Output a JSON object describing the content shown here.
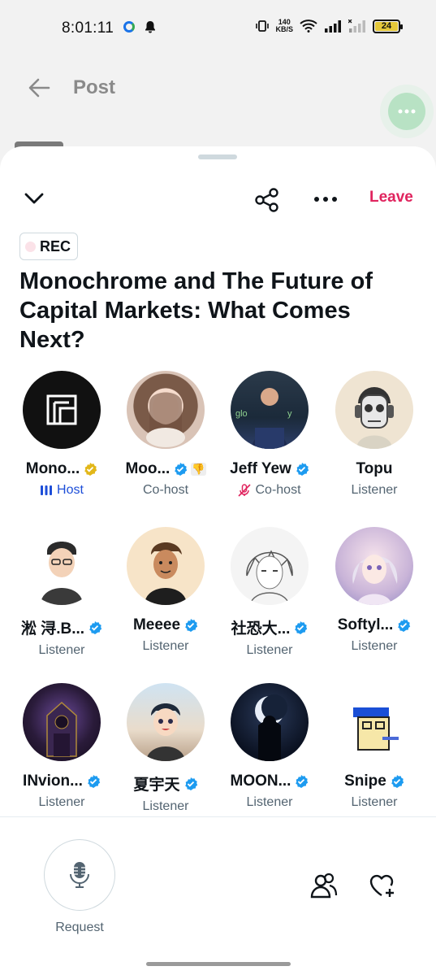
{
  "status_bar": {
    "time": "8:01:11",
    "net_speed_top": "140",
    "net_speed_bottom": "KB/S",
    "battery": "24"
  },
  "post_header": {
    "title": "Post"
  },
  "space": {
    "rec_label": "REC",
    "title": "Monochrome and The Future of Capital Markets: What Comes Next?",
    "leave_label": "Leave"
  },
  "participants": [
    {
      "name": "Mono...",
      "role": "Host",
      "verified": "gold",
      "avatar": "monochrome-logo"
    },
    {
      "name": "Moo...",
      "role": "Co-host",
      "verified": "blue",
      "extra": "👎",
      "avatar": "portrait-woman"
    },
    {
      "name": "Jeff Yew",
      "role": "Co-host",
      "verified": "blue",
      "muted": true,
      "avatar": "portrait-speaker"
    },
    {
      "name": "Topu",
      "role": "Listener",
      "verified": "none",
      "avatar": "skull-headphones"
    },
    {
      "name": "淞 浔.B...",
      "role": "Listener",
      "verified": "blue",
      "avatar": "cartoon-man"
    },
    {
      "name": "Meeee",
      "role": "Listener",
      "verified": "blue",
      "avatar": "cartoon-man-2"
    },
    {
      "name": "社恐大...",
      "role": "Listener",
      "verified": "blue",
      "avatar": "sketch-anime"
    },
    {
      "name": "Softyl...",
      "role": "Listener",
      "verified": "blue",
      "avatar": "anime-girl"
    },
    {
      "name": "INvion...",
      "role": "Listener",
      "verified": "blue",
      "avatar": "dark-throne"
    },
    {
      "name": "夏宇天",
      "role": "Listener",
      "verified": "blue",
      "avatar": "anime-boy"
    },
    {
      "name": "MOON...",
      "role": "Listener",
      "verified": "blue",
      "avatar": "moon-silhouette"
    },
    {
      "name": "Snipe",
      "role": "Listener",
      "verified": "blue",
      "avatar": "pixel-character"
    }
  ],
  "bottom": {
    "request_label": "Request"
  },
  "colors": {
    "accent_leave": "#e0245e",
    "verified_blue": "#1d9bf0",
    "verified_gold": "#e2b719",
    "host_blue": "#1d4ed8",
    "fab_green": "#b8e2c4"
  }
}
